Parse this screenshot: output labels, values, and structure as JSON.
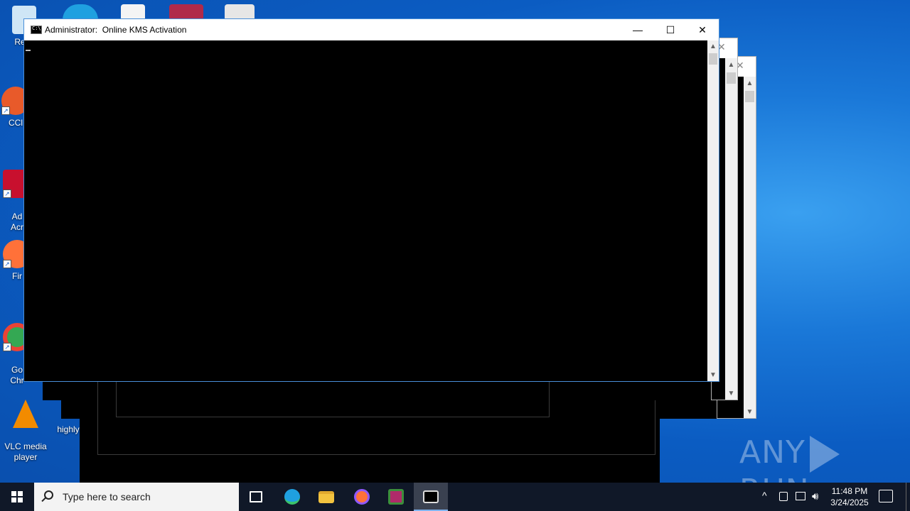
{
  "desktop": {
    "icons": [
      {
        "label": "Recy",
        "color": "#cfe6f6"
      },
      {
        "label": "CCl",
        "color": "#e85a2a"
      },
      {
        "label": "Ad\nAcr",
        "color": "#c8102e"
      },
      {
        "label": "Fir",
        "color": "#ff7139"
      },
      {
        "label": "Go\nChr",
        "color": "#34a853"
      },
      {
        "label": "VLC media\nplayer",
        "color": "#f28b00"
      }
    ],
    "partial_label": "highly"
  },
  "window": {
    "title": "Administrator:  Online KMS Activation",
    "minimize": "—",
    "maximize": "☐",
    "close": "✕"
  },
  "bg_windows": {
    "close_glyph": "✕",
    "scroll_up": "▲",
    "scroll_down": "▼"
  },
  "watermark": {
    "left": "ANY",
    "right": "RUN"
  },
  "taskbar": {
    "search_placeholder": "Type here to search",
    "apps": [
      {
        "name": "task-view",
        "color": "#ffffff"
      },
      {
        "name": "edge",
        "color": "#1fa0e0"
      },
      {
        "name": "file-explorer",
        "color": "#f3c33f"
      },
      {
        "name": "firefox",
        "color": "#ff7139"
      },
      {
        "name": "winrar",
        "color": "#b02a6a"
      },
      {
        "name": "command-prompt",
        "color": "#000000"
      }
    ],
    "time": "11:48 PM",
    "date": "3/24/2025",
    "tray_chevron": "^"
  }
}
